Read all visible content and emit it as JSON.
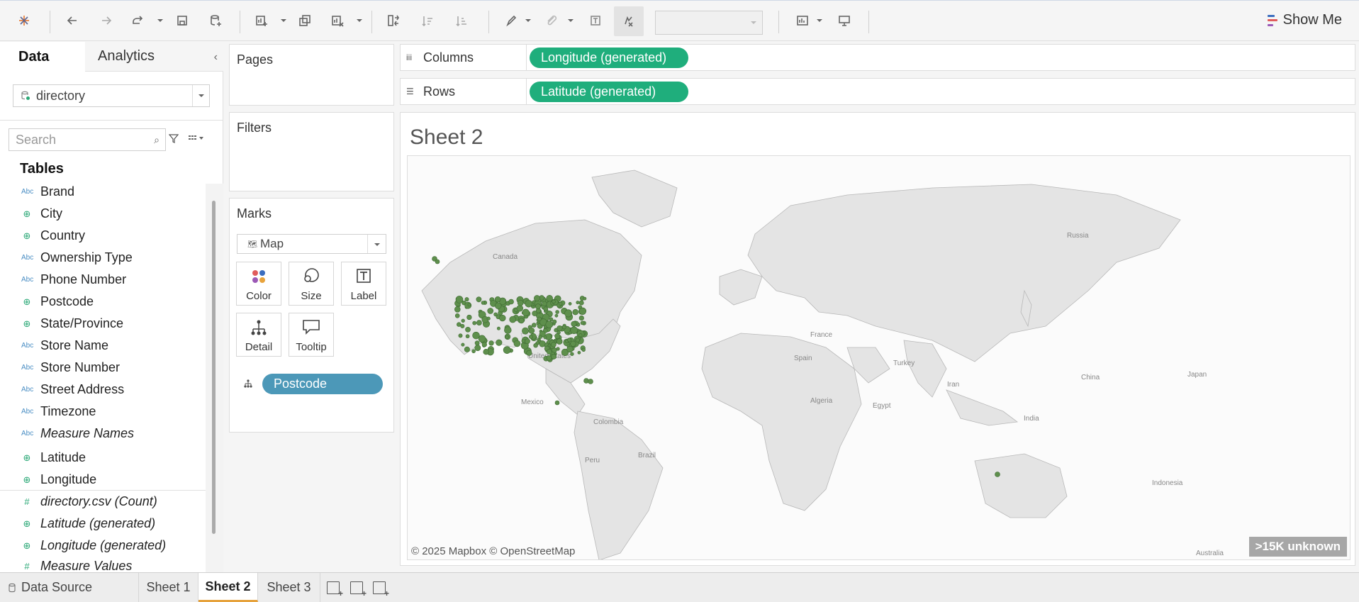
{
  "toolbar": {
    "show_me_label": "Show Me",
    "show_me_colors": [
      "#3b6dbf",
      "#e05c5c",
      "#9b59b6"
    ]
  },
  "data_pane": {
    "tab_data": "Data",
    "tab_analytics": "Analytics",
    "datasource": "directory",
    "search_placeholder": "Search",
    "tables_heading": "Tables",
    "dimensions": [
      {
        "name": "Brand",
        "type": "Abc",
        "italic": false
      },
      {
        "name": "City",
        "type": "geo",
        "italic": false
      },
      {
        "name": "Country",
        "type": "geo",
        "italic": false
      },
      {
        "name": "Ownership Type",
        "type": "Abc",
        "italic": false
      },
      {
        "name": "Phone Number",
        "type": "Abc",
        "italic": false
      },
      {
        "name": "Postcode",
        "type": "geo",
        "italic": false
      },
      {
        "name": "State/Province",
        "type": "geo",
        "italic": false
      },
      {
        "name": "Store Name",
        "type": "Abc",
        "italic": false
      },
      {
        "name": "Store Number",
        "type": "Abc",
        "italic": false
      },
      {
        "name": "Street Address",
        "type": "Abc",
        "italic": false
      },
      {
        "name": "Timezone",
        "type": "Abc",
        "italic": false
      },
      {
        "name": "Measure Names",
        "type": "Abc",
        "italic": true
      }
    ],
    "measures": [
      {
        "name": "Latitude",
        "type": "geo",
        "italic": false
      },
      {
        "name": "Longitude",
        "type": "geo",
        "italic": false
      },
      {
        "name": "directory.csv (Count)",
        "type": "#",
        "italic": true
      },
      {
        "name": "Latitude (generated)",
        "type": "geo",
        "italic": true
      },
      {
        "name": "Longitude (generated)",
        "type": "geo",
        "italic": true
      },
      {
        "name": "Measure Values",
        "type": "#",
        "italic": true
      }
    ]
  },
  "cards": {
    "pages": "Pages",
    "filters": "Filters",
    "marks": "Marks",
    "mark_type": "Map",
    "buttons": {
      "color": "Color",
      "size": "Size",
      "label": "Label",
      "detail": "Detail",
      "tooltip": "Tooltip"
    },
    "detail_pill": "Postcode"
  },
  "shelves": {
    "columns_label": "Columns",
    "columns_pill": "Longitude (generated)",
    "rows_label": "Rows",
    "rows_pill": "Latitude (generated)"
  },
  "view": {
    "title": "Sheet 2",
    "credit": "© 2025 Mapbox © OpenStreetMap",
    "unknown_badge": ">15K unknown",
    "map_labels": [
      "Canada",
      "United States",
      "Mexico",
      "Colombia",
      "Peru",
      "Brazil",
      "Russia",
      "France",
      "Spain",
      "Turkey",
      "Algeria",
      "Egypt",
      "Iran",
      "India",
      "China",
      "Japan",
      "Indonesia",
      "Australia"
    ],
    "mark_color": "#5e8f4c"
  },
  "bottom_tabs": {
    "data_source": "Data Source",
    "sheets": [
      "Sheet 1",
      "Sheet 2",
      "Sheet 3"
    ],
    "active_sheet": "Sheet 2"
  }
}
